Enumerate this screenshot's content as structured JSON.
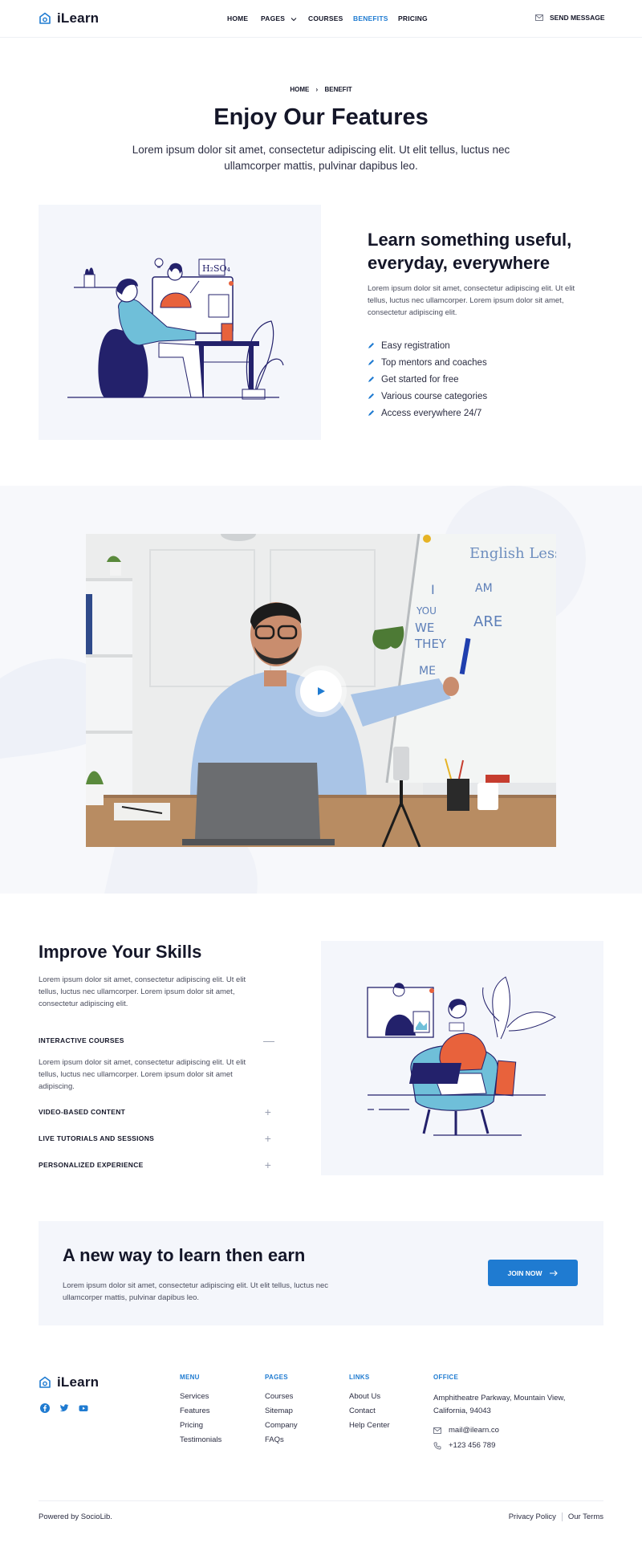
{
  "header": {
    "logo_text": "iLearn",
    "nav": [
      {
        "label": "HOME"
      },
      {
        "label": "PAGES"
      },
      {
        "label": "COURSES"
      },
      {
        "label": "BENEFITS"
      },
      {
        "label": "PRICING"
      }
    ],
    "send_message": "SEND MESSAGE"
  },
  "hero": {
    "breadcrumb_home": "HOME",
    "breadcrumb_current": "BENEFIT",
    "title": "Enjoy Our Features",
    "subtitle": "Lorem ipsum dolor sit amet, consectetur adipiscing elit. Ut elit tellus, luctus nec ullamcorper mattis, pulvinar dapibus leo."
  },
  "feature": {
    "title": "Learn something useful, everyday, everywhere",
    "paragraph": "Lorem ipsum dolor sit amet, consectetur adipiscing elit. Ut elit tellus, luctus nec ullamcorper. Lorem ipsum dolor sit amet, consectetur adipiscing elit.",
    "items": [
      "Easy registration",
      "Top mentors and coaches",
      "Get started for free",
      "Various course categories",
      "Access everywhere 24/7"
    ]
  },
  "video": {
    "board_text_1": "English Lesson",
    "board_text_2": "I",
    "board_text_3": "YOU",
    "board_text_4": "WE",
    "board_text_5": "THEY",
    "board_text_6": "AM",
    "board_text_7": "ARE",
    "board_text_8": "ME"
  },
  "skills": {
    "title": "Improve Your Skills",
    "paragraph": "Lorem ipsum dolor sit amet, consectetur adipiscing elit. Ut elit tellus, luctus nec ullamcorper. Lorem ipsum dolor sit amet, consectetur adipiscing elit.",
    "accordion": [
      {
        "title": "INTERACTIVE COURSES",
        "icon": "—",
        "body": "Lorem ipsum dolor sit amet, consectetur adipiscing elit. Ut elit tellus, luctus nec ullamcorper. Lorem ipsum dolor sit amet adipiscing."
      },
      {
        "title": "VIDEO-BASED CONTENT",
        "icon": "+"
      },
      {
        "title": "LIVE TUTORIALS AND SESSIONS",
        "icon": "+"
      },
      {
        "title": "PERSONALIZED EXPERIENCE",
        "icon": "+"
      }
    ]
  },
  "cta": {
    "title": "A new way to learn then earn",
    "paragraph": "Lorem ipsum dolor sit amet, consectetur adipiscing elit. Ut elit tellus, luctus nec ullamcorper mattis, pulvinar dapibus leo.",
    "button": "JOIN NOW"
  },
  "footer": {
    "logo_text": "iLearn",
    "menu": {
      "title": "MENU",
      "links": [
        "Services",
        "Features",
        "Pricing",
        "Testimonials"
      ]
    },
    "pages": {
      "title": "PAGES",
      "links": [
        "Courses",
        "Sitemap",
        "Company",
        "FAQs"
      ]
    },
    "links": {
      "title": "LINKS",
      "links": [
        "About Us",
        "Contact",
        "Help Center"
      ]
    },
    "office": {
      "title": "OFFICE",
      "address": "Amphitheatre Parkway, Mountain View, California, 94043",
      "email": "mail@ilearn.co",
      "phone": "+123 456 789"
    },
    "powered": "Powered by SocioLib.",
    "privacy": "Privacy Policy",
    "terms": "Our Terms"
  },
  "colors": {
    "accent": "#1f7bd1",
    "dark": "#141628",
    "navy": "#23216b",
    "orange": "#e8623c",
    "teal": "#6fbfd9"
  }
}
